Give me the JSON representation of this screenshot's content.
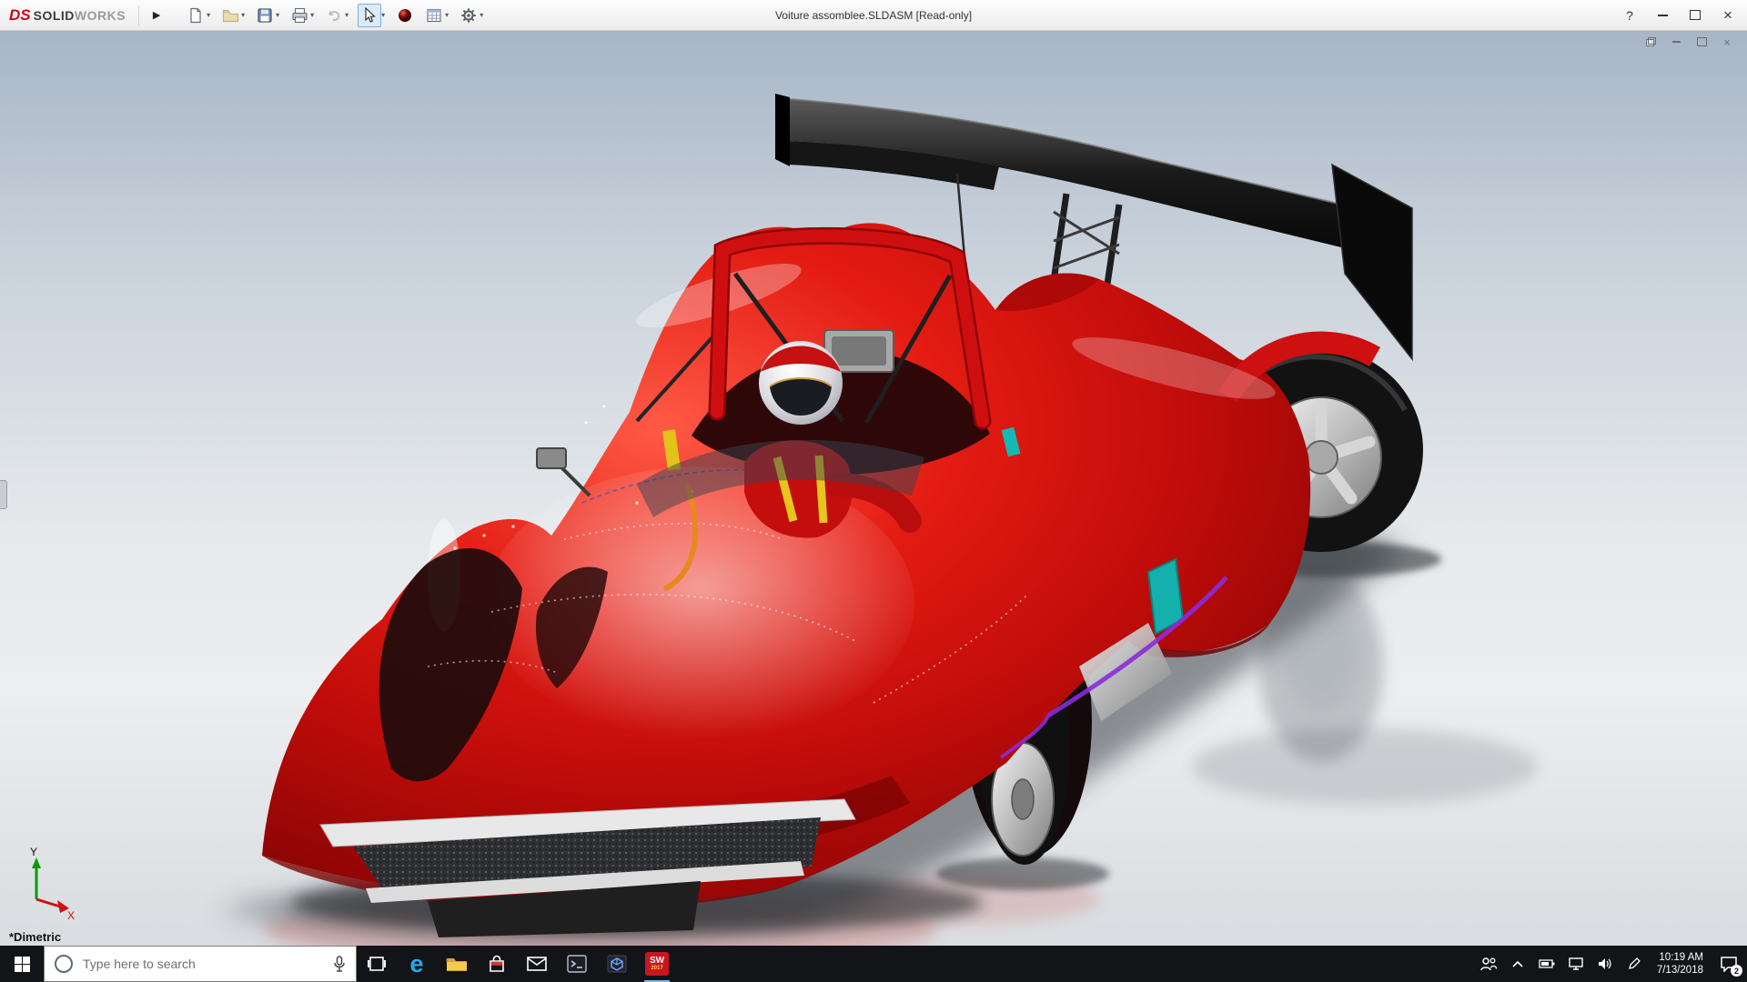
{
  "titlebar": {
    "logo_prefix": "DS",
    "logo_bold": "SOLID",
    "logo_light": "WORKS",
    "flyout_arrow": "▶",
    "title": "Voiture assomblee.SLDASM [Read-only]",
    "help_label": "?"
  },
  "toolbar": {
    "dropdown_glyph": "▾",
    "icons": [
      "new-document",
      "open",
      "save",
      "print",
      "undo",
      "select",
      "appearances",
      "design-table",
      "options"
    ]
  },
  "viewport": {
    "orientation_label": "*Dimetric",
    "triad_x": "X",
    "triad_y": "Y",
    "model_colors": {
      "body_red": "#d41212",
      "wing_black": "#121212",
      "accent_teal": "#14b8b4",
      "trim_purple": "#8a2bd8",
      "rim_silver": "#c9c9c9"
    }
  },
  "taskbar": {
    "search_placeholder": "Type here to search",
    "edge_glyph": "e",
    "sw_label": "SW",
    "sw_year": "2017",
    "time": "10:19 AM",
    "date": "7/13/2018",
    "notification_count": "2",
    "app_icons": [
      "task-view",
      "edge",
      "file-explorer",
      "store",
      "mail",
      "command-prompt",
      "edrawings",
      "solidworks-2017"
    ],
    "tray_icons": [
      "people",
      "chevron-up",
      "battery",
      "network",
      "volume",
      "pen"
    ]
  }
}
